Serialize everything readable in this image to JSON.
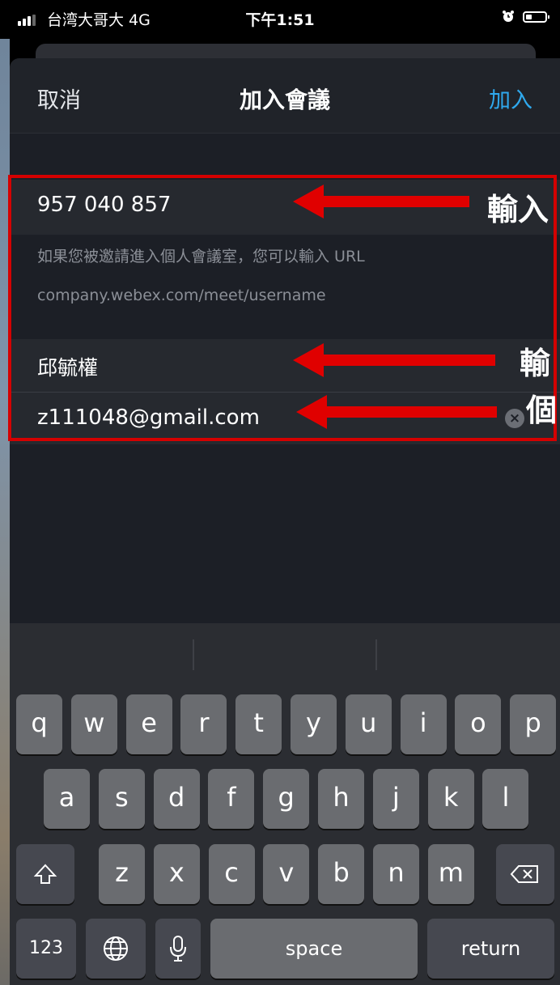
{
  "status_bar": {
    "carrier": "台湾大哥大  4G",
    "time": "下午1:51"
  },
  "nav": {
    "cancel": "取消",
    "title": "加入會議",
    "join": "加入"
  },
  "form": {
    "meeting_number": "957 040 857",
    "hint_text": "如果您被邀請進入個人會議室，您可以輸入 URL",
    "url_placeholder": "company.webex.com/meet/username",
    "name": "邱毓權",
    "email": "z111048@gmail.com"
  },
  "annotations": {
    "label1": "輸入",
    "label2": "輸",
    "label3": "個"
  },
  "keyboard": {
    "row1": [
      "q",
      "w",
      "e",
      "r",
      "t",
      "y",
      "u",
      "i",
      "o",
      "p"
    ],
    "row2": [
      "a",
      "s",
      "d",
      "f",
      "g",
      "h",
      "j",
      "k",
      "l"
    ],
    "row3": [
      "z",
      "x",
      "c",
      "v",
      "b",
      "n",
      "m"
    ],
    "numbers": "123",
    "space": "space",
    "return": "return"
  },
  "colors": {
    "accent": "#2fa9ee",
    "annotation": "#e00000"
  }
}
